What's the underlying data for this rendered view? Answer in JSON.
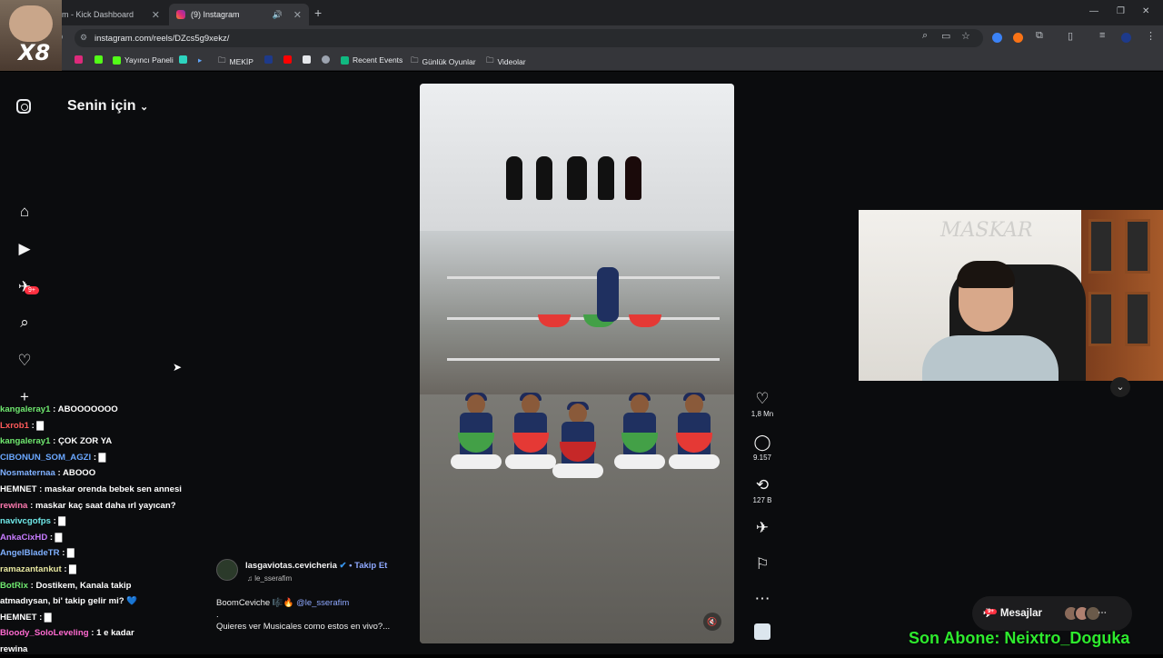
{
  "browser": {
    "tabs": [
      {
        "title": "m - Kick Dashboard",
        "active": false
      },
      {
        "title": "(9) Instagram",
        "active": true
      }
    ],
    "url": "instagram.com/reels/DZcs5g9xekz/",
    "bookmarks": [
      {
        "label": "",
        "icon": "x-icon"
      },
      {
        "label": "",
        "icon": "instagram-icon"
      },
      {
        "label": "Yayıncı Paneli",
        "icon": "kick-icon"
      },
      {
        "label": "",
        "icon": "kick-icon"
      },
      {
        "label": "",
        "icon": "app-icon"
      },
      {
        "label": "",
        "icon": "play-icon"
      },
      {
        "label": "MEKİP",
        "icon": "folder-icon"
      },
      {
        "label": "",
        "icon": "app-icon"
      },
      {
        "label": "",
        "icon": "youtube-icon"
      },
      {
        "label": "",
        "icon": "app-icon"
      },
      {
        "label": "",
        "icon": "app-icon"
      },
      {
        "label": "Recent Events",
        "icon": "app-icon"
      },
      {
        "label": "Günlük Oyunlar",
        "icon": "folder-icon"
      },
      {
        "label": "Videolar",
        "icon": "folder-icon"
      }
    ],
    "overlay_logo": "X8"
  },
  "instagram": {
    "feed_title": "Senin için",
    "notif_badge": "9+",
    "nav": [
      "home-icon",
      "reels-icon",
      "messages-icon",
      "search-icon",
      "heart-icon",
      "create-icon"
    ],
    "reel": {
      "likes": "1,8 Mn",
      "comments": "9.157",
      "reposts": "127 B",
      "username": "lasgaviotas.cevicheria",
      "verified": "✔",
      "follow": "• Takip Et",
      "music": "le_sserafim",
      "caption_line1_text": "BoomCeviche 🎼🔥",
      "caption_mention": "@le_sserafim",
      "caption_line2": ".",
      "caption_line3": "Quieres ver Musicales como estos en vivo?..."
    },
    "messages_label": "Mesajlar",
    "messages_badge": "9+"
  },
  "chat": [
    {
      "user": "kangaleray1",
      "sep": " : ",
      "text": "ABOOOOOOO",
      "color": "#6fe86f"
    },
    {
      "user": "Lxrob1",
      "sep": " : ",
      "text": "▇",
      "color": "#ff5a5a"
    },
    {
      "user": "kangaleray1",
      "sep": " : ",
      "text": "ÇOK ZOR YA",
      "color": "#6fe86f"
    },
    {
      "user": "CIBONUN_SOM_AGZI",
      "sep": " : ",
      "text": "▇",
      "color": "#6aa7ff"
    },
    {
      "user": "Nosmaternaa",
      "sep": " : ",
      "text": "ABOOO",
      "color": "#7fb0ff"
    },
    {
      "user": "HEMNET",
      "sep": " : ",
      "text": "maskar orenda bebek sen annesi",
      "color": "#ffffff"
    },
    {
      "user": "rewina",
      "sep": " : ",
      "text": "maskar kaç saat daha ırl yayıcan?",
      "color": "#ff7ab0"
    },
    {
      "user": "navivcgofps",
      "sep": " : ",
      "text": "▇",
      "color": "#6fe8e8"
    },
    {
      "user": "AnkaCixHD",
      "sep": " : ",
      "text": "▇",
      "color": "#c77bff"
    },
    {
      "user": "AngelBladeTR",
      "sep": " : ",
      "text": "▇",
      "color": "#7fb0ff"
    },
    {
      "user": "ramazantankut",
      "sep": " : ",
      "text": "▇",
      "color": "#e8e8a0"
    },
    {
      "user": "BotRix",
      "sep": " : ",
      "text": "Dostikem, Kanala takip",
      "color": "#6fe86f"
    },
    {
      "user": "",
      "sep": "",
      "text": "atmadıysan, bi' takip gelir mi? 💙",
      "color": "#ffffff"
    },
    {
      "user": "HEMNET",
      "sep": " : ",
      "text": "▇",
      "color": "#ffffff"
    },
    {
      "user": "Bloody_SoloLeveling",
      "sep": " : ",
      "text": "1 e kadar",
      "color": "#ff6ad0"
    },
    {
      "user": "",
      "sep": "",
      "text": "rewina",
      "color": "#ffffff"
    }
  ],
  "stream_overlay": {
    "last_sub": "Son Abone: Neixtro_Doguka",
    "webcam_watermark": "MASKAR"
  },
  "colors": {
    "chrome_bg": "#202124",
    "toolbar_bg": "#35363a",
    "page_bg": "#0b0c0e",
    "accent_badge": "#ff3040",
    "sub_banner": "#2eea2e"
  }
}
